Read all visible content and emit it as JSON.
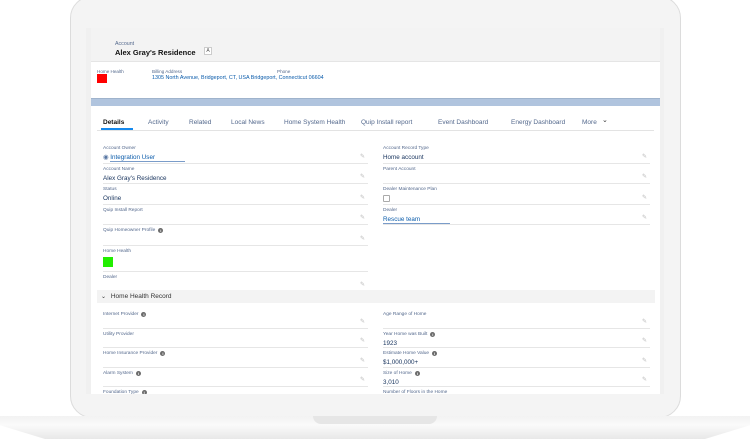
{
  "header": {
    "object_label": "Account",
    "title": "Alex Gray's Residence",
    "badge": "A"
  },
  "highlights": {
    "home_health_label": "Home Health",
    "home_health_color": "#ff0000",
    "billing_label": "Billing Address",
    "billing_value": "1305 North Avenue, Bridgeport, CT, USA Bridgeport,  Connecticut 06604",
    "phone_label": "Phone"
  },
  "tabs": [
    "Details",
    "Activity",
    "Related",
    "Local News",
    "Home System Health",
    "Quip Install report",
    "Event Dashboard",
    "Energy Dashboard",
    "More"
  ],
  "active_tab": "Details",
  "left_fields": [
    {
      "label": "Account Owner",
      "value": "Integration User",
      "link": true,
      "icon": "user-icon"
    },
    {
      "label": "Account Name",
      "value": "Alex Gray's Residence"
    },
    {
      "label": "Status",
      "value": "Online"
    },
    {
      "label": "Quip Install Report",
      "value": ""
    },
    {
      "label": "Quip Homeowner Profile",
      "value": "",
      "info": true
    },
    {
      "label": "Home Health",
      "value": "",
      "color": "#22ee00"
    },
    {
      "label": "Dealer",
      "value": ""
    }
  ],
  "right_fields": [
    {
      "label": "Account Record Type",
      "value": "Home account"
    },
    {
      "label": "Parent Account",
      "value": ""
    },
    {
      "label": "Dealer Maintenance Plan",
      "value": "",
      "checkbox": true,
      "checked": false
    },
    {
      "label": "Dealer",
      "value": "Rescue team",
      "link": true
    }
  ],
  "section": {
    "title": "Home Health Record",
    "left": [
      {
        "label": "Internet Provider",
        "value": "",
        "info": true
      },
      {
        "label": "Utility Provider",
        "value": ""
      },
      {
        "label": "Home Insurance Provider",
        "value": "",
        "info": true
      },
      {
        "label": "Alarm System",
        "value": "",
        "info": true
      },
      {
        "label": "Foundation Type",
        "value": "",
        "info": true
      }
    ],
    "right": [
      {
        "label": "Age Range of Home",
        "value": ""
      },
      {
        "label": "Year Home was Built",
        "value": "1923",
        "info": true
      },
      {
        "label": "Estimate Home Value",
        "value": "$1,000,000+",
        "info": true
      },
      {
        "label": "Size of Home",
        "value": "3,010",
        "info": true
      },
      {
        "label": "Number of Floors in the Home",
        "value": ""
      }
    ]
  },
  "colors": {
    "banner": "#b0c4de",
    "link": "#0b5cab"
  }
}
